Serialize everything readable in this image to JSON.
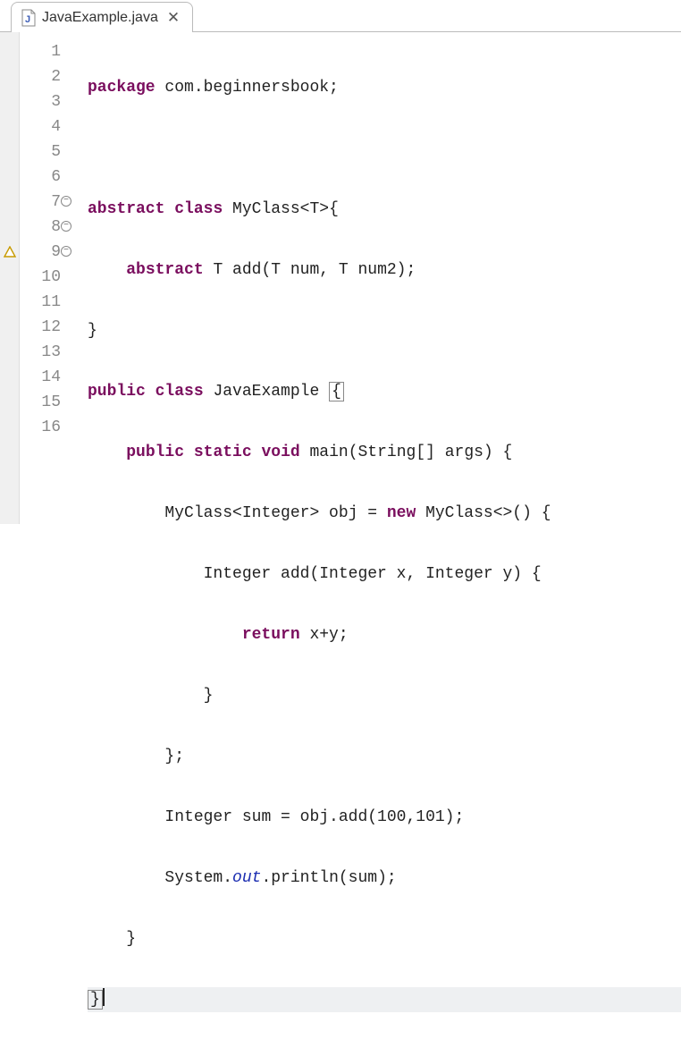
{
  "tab": {
    "filename": "JavaExample.java",
    "close_glyph": "✕"
  },
  "gutter": {
    "lines": [
      "1",
      "2",
      "3",
      "4",
      "5",
      "6",
      "7",
      "8",
      "9",
      "10",
      "11",
      "12",
      "13",
      "14",
      "15",
      "16"
    ],
    "foldable": [
      7,
      8,
      9
    ],
    "warning_at": 9
  },
  "tokens": {
    "kw_package": "package",
    "kw_abstract": "abstract",
    "kw_class": "class",
    "kw_public": "public",
    "kw_static": "static",
    "kw_void": "void",
    "kw_new": "new",
    "kw_return": "return",
    "pkg_name": " com.beginnersbook;",
    "cls_decl": " MyClass<T>{",
    "abs_method": " T add(T num, T num2);",
    "close_brace": "}",
    "java_cls": " JavaExample ",
    "open_brace": "{",
    "main_sig": " main(String[] args) {",
    "obj_decl": "MyClass<Integer> obj = ",
    "anon_start": " MyClass<>() {",
    "add_sig": "Integer add(Integer x, Integer y) {",
    "return_body": " x+y;",
    "anon_close": "};",
    "sum_line": "Integer sum = obj.add(100,101);",
    "sys": "System.",
    "out": "out",
    "println": ".println(sum);"
  },
  "indent": {
    "i1": "    ",
    "i2": "        ",
    "i3": "            ",
    "i4": "                ",
    "i5": "                    "
  }
}
